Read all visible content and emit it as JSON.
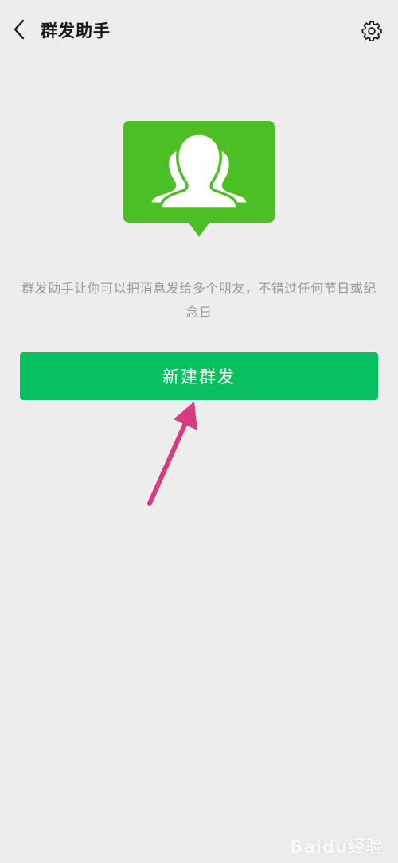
{
  "header": {
    "title": "群发助手",
    "back_icon": "chevron-left-icon",
    "settings_icon": "gear-icon"
  },
  "illustration": {
    "icon": "group-chat-icon",
    "color": "#4cbf24"
  },
  "main": {
    "description": "群发助手让你可以把消息发给多个朋友，不错过任何节日或纪念日",
    "new_broadcast_label": "新建群发",
    "button_color": "#07c160"
  },
  "annotation": {
    "arrow_color": "#d63c82"
  },
  "watermark": {
    "text": "Baidu经验"
  }
}
